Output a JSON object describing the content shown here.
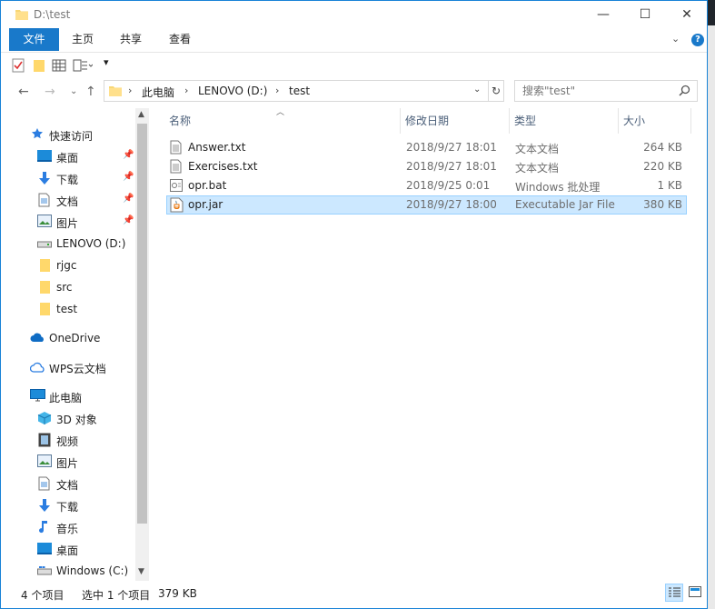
{
  "window": {
    "title": "D:\\test"
  },
  "window_controls": {
    "minimize": "—",
    "maximize": "☐",
    "close": "✕"
  },
  "ribbon": {
    "tabs": [
      {
        "label": "文件",
        "active": true
      },
      {
        "label": "主页"
      },
      {
        "label": "共享"
      },
      {
        "label": "查看"
      }
    ],
    "help": "?"
  },
  "address": {
    "segments": [
      "此电脑",
      "LENOVO (D:)",
      "test"
    ]
  },
  "search": {
    "placeholder": "搜索\"test\""
  },
  "nav": {
    "items": [
      {
        "label": "快速访问",
        "icon": "star-icon",
        "level": 0
      },
      {
        "label": "桌面",
        "icon": "desktop-icon",
        "level": 1,
        "pinned": true
      },
      {
        "label": "下载",
        "icon": "download-icon",
        "level": 1,
        "pinned": true
      },
      {
        "label": "文档",
        "icon": "document-icon",
        "level": 1,
        "pinned": true
      },
      {
        "label": "图片",
        "icon": "pictures-icon",
        "level": 1,
        "pinned": true
      },
      {
        "label": "LENOVO (D:)",
        "icon": "drive-icon",
        "level": 1
      },
      {
        "label": "rjgc",
        "icon": "folder-icon",
        "level": 1
      },
      {
        "label": "src",
        "icon": "folder-icon",
        "level": 1
      },
      {
        "label": "test",
        "icon": "folder-icon",
        "level": 1
      },
      {
        "label": "OneDrive",
        "icon": "onedrive-icon",
        "level": 0
      },
      {
        "label": "WPS云文档",
        "icon": "cloud-icon",
        "level": 0
      },
      {
        "label": "此电脑",
        "icon": "computer-icon",
        "level": 0
      },
      {
        "label": "3D 对象",
        "icon": "3d-objects-icon",
        "level": 1
      },
      {
        "label": "视频",
        "icon": "video-icon",
        "level": 1
      },
      {
        "label": "图片",
        "icon": "pictures-icon",
        "level": 1
      },
      {
        "label": "文档",
        "icon": "document-icon",
        "level": 1
      },
      {
        "label": "下载",
        "icon": "download-icon",
        "level": 1
      },
      {
        "label": "音乐",
        "icon": "music-icon",
        "level": 1
      },
      {
        "label": "桌面",
        "icon": "desktop-icon",
        "level": 1
      },
      {
        "label": "Windows (C:)",
        "icon": "windows-drive-icon",
        "level": 1
      }
    ]
  },
  "columns": {
    "name": "名称",
    "modified": "修改日期",
    "type": "类型",
    "size": "大小"
  },
  "files": [
    {
      "name": "Answer.txt",
      "modified": "2018/9/27 18:01",
      "type": "文本文档",
      "size": "264 KB",
      "icon": "text-file-icon"
    },
    {
      "name": "Exercises.txt",
      "modified": "2018/9/27 18:01",
      "type": "文本文档",
      "size": "220 KB",
      "icon": "text-file-icon"
    },
    {
      "name": "opr.bat",
      "modified": "2018/9/25 0:01",
      "type": "Windows 批处理",
      "size": "1 KB",
      "icon": "batch-file-icon"
    },
    {
      "name": "opr.jar",
      "modified": "2018/9/27 18:00",
      "type": "Executable Jar File",
      "size": "380 KB",
      "icon": "jar-file-icon",
      "selected": true
    }
  ],
  "status": {
    "count": "4 个项目",
    "selection": "选中 1 个项目",
    "selection_size": "379 KB"
  }
}
